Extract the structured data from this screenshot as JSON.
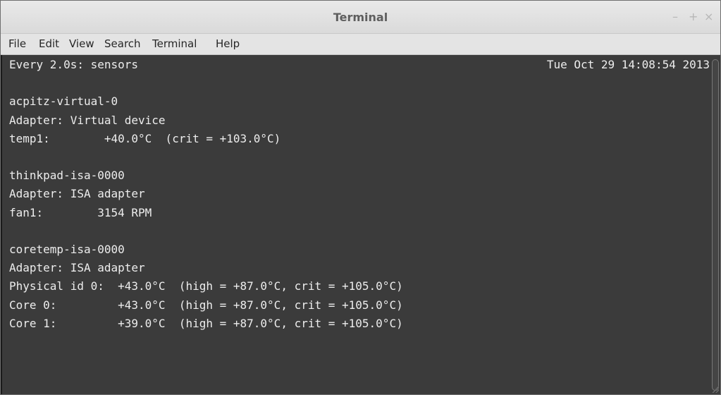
{
  "window": {
    "title": "Terminal",
    "controls": {
      "minimize": "–",
      "maximize": "+",
      "close": "×"
    }
  },
  "menu": {
    "items": [
      "File",
      "Edit",
      "View",
      "Search",
      "Terminal",
      "Help"
    ]
  },
  "terminal": {
    "header_left": "Every 2.0s: sensors",
    "header_right": "Tue Oct 29 14:08:54 2013",
    "lines": [
      "",
      "acpitz-virtual-0",
      "Adapter: Virtual device",
      "temp1:        +40.0°C  (crit = +103.0°C)",
      "",
      "thinkpad-isa-0000",
      "Adapter: ISA adapter",
      "fan1:        3154 RPM",
      "",
      "coretemp-isa-0000",
      "Adapter: ISA adapter",
      "Physical id 0:  +43.0°C  (high = +87.0°C, crit = +105.0°C)",
      "Core 0:         +43.0°C  (high = +87.0°C, crit = +105.0°C)",
      "Core 1:         +39.0°C  (high = +87.0°C, crit = +105.0°C)"
    ]
  },
  "colors": {
    "terminal_bg": "#3b3b3b",
    "terminal_fg": "#ededed",
    "titlebar_bg": "#e2e2e2",
    "menubar_bg": "#e4e4e4"
  }
}
